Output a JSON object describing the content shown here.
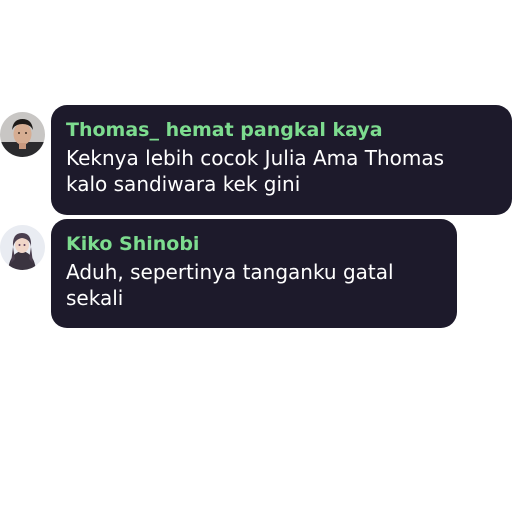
{
  "messages": [
    {
      "sender": "Thomas_ hemat pangkal kaya",
      "lines": [
        "Keknya lebih cocok Julia Ama Thomas",
        "kalo sandiwara kek gini"
      ],
      "avatar_icon": "man-portrait-icon"
    },
    {
      "sender": "Kiko Shinobi",
      "lines": [
        "Aduh, sepertinya tanganku gatal",
        "sekali"
      ],
      "avatar_icon": "anime-girl-portrait-icon"
    }
  ],
  "colors": {
    "bubble_bg": "#1d1a2b",
    "sender_name": "#7ddc8f",
    "message_text": "#ffffff"
  }
}
